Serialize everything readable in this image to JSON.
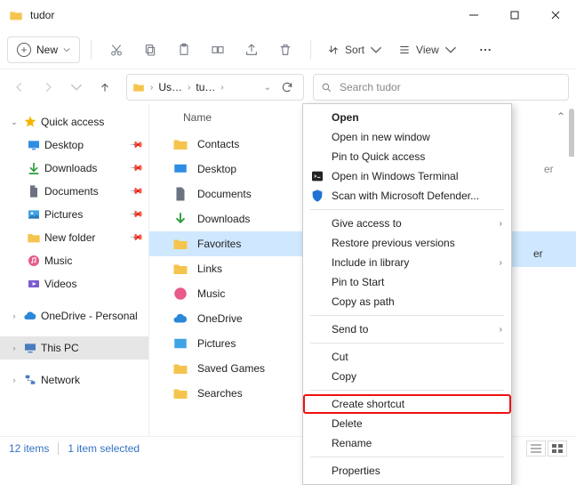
{
  "titlebar": {
    "title": "tudor"
  },
  "toolbar": {
    "new_label": "New",
    "sort_label": "Sort",
    "view_label": "View"
  },
  "address": {
    "crumb1": "Us…",
    "crumb2": "tu…"
  },
  "search": {
    "placeholder": "Search tudor"
  },
  "sidebar": {
    "quick_access": "Quick access",
    "desktop": "Desktop",
    "downloads": "Downloads",
    "documents": "Documents",
    "pictures": "Pictures",
    "new_folder": "New folder",
    "music": "Music",
    "videos": "Videos",
    "onedrive": "OneDrive - Personal",
    "this_pc": "This PC",
    "network": "Network"
  },
  "listhead": {
    "name": "Name"
  },
  "rows": {
    "contacts": "Contacts",
    "desktop": "Desktop",
    "documents": "Documents",
    "downloads": "Downloads",
    "favorites": "Favorites",
    "links": "Links",
    "music": "Music",
    "onedrive": "OneDrive",
    "pictures": "Pictures",
    "saved_games": "Saved Games",
    "searches": "Searches"
  },
  "right_peek": {
    "r1": "er",
    "r2": "er"
  },
  "context_menu": {
    "open": "Open",
    "open_new_window": "Open in new window",
    "pin_quick_access": "Pin to Quick access",
    "open_terminal": "Open in Windows Terminal",
    "scan_defender": "Scan with Microsoft Defender...",
    "give_access_to": "Give access to",
    "restore_previous": "Restore previous versions",
    "include_library": "Include in library",
    "pin_start": "Pin to Start",
    "copy_as_path": "Copy as path",
    "send_to": "Send to",
    "cut": "Cut",
    "copy": "Copy",
    "create_shortcut": "Create shortcut",
    "delete": "Delete",
    "rename": "Rename",
    "properties": "Properties"
  },
  "status": {
    "count": "12 items",
    "selected": "1 item selected"
  }
}
